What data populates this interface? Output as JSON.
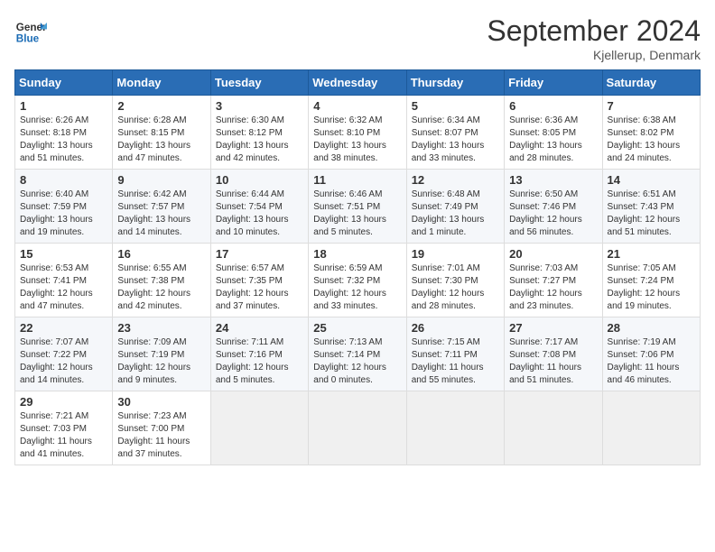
{
  "header": {
    "logo_line1": "General",
    "logo_line2": "Blue",
    "month_title": "September 2024",
    "location": "Kjellerup, Denmark"
  },
  "weekdays": [
    "Sunday",
    "Monday",
    "Tuesday",
    "Wednesday",
    "Thursday",
    "Friday",
    "Saturday"
  ],
  "weeks": [
    [
      {
        "day": "1",
        "sunrise": "6:26 AM",
        "sunset": "8:18 PM",
        "daylight": "13 hours and 51 minutes."
      },
      {
        "day": "2",
        "sunrise": "6:28 AM",
        "sunset": "8:15 PM",
        "daylight": "13 hours and 47 minutes."
      },
      {
        "day": "3",
        "sunrise": "6:30 AM",
        "sunset": "8:12 PM",
        "daylight": "13 hours and 42 minutes."
      },
      {
        "day": "4",
        "sunrise": "6:32 AM",
        "sunset": "8:10 PM",
        "daylight": "13 hours and 38 minutes."
      },
      {
        "day": "5",
        "sunrise": "6:34 AM",
        "sunset": "8:07 PM",
        "daylight": "13 hours and 33 minutes."
      },
      {
        "day": "6",
        "sunrise": "6:36 AM",
        "sunset": "8:05 PM",
        "daylight": "13 hours and 28 minutes."
      },
      {
        "day": "7",
        "sunrise": "6:38 AM",
        "sunset": "8:02 PM",
        "daylight": "13 hours and 24 minutes."
      }
    ],
    [
      {
        "day": "8",
        "sunrise": "6:40 AM",
        "sunset": "7:59 PM",
        "daylight": "13 hours and 19 minutes."
      },
      {
        "day": "9",
        "sunrise": "6:42 AM",
        "sunset": "7:57 PM",
        "daylight": "13 hours and 14 minutes."
      },
      {
        "day": "10",
        "sunrise": "6:44 AM",
        "sunset": "7:54 PM",
        "daylight": "13 hours and 10 minutes."
      },
      {
        "day": "11",
        "sunrise": "6:46 AM",
        "sunset": "7:51 PM",
        "daylight": "13 hours and 5 minutes."
      },
      {
        "day": "12",
        "sunrise": "6:48 AM",
        "sunset": "7:49 PM",
        "daylight": "13 hours and 1 minute."
      },
      {
        "day": "13",
        "sunrise": "6:50 AM",
        "sunset": "7:46 PM",
        "daylight": "12 hours and 56 minutes."
      },
      {
        "day": "14",
        "sunrise": "6:51 AM",
        "sunset": "7:43 PM",
        "daylight": "12 hours and 51 minutes."
      }
    ],
    [
      {
        "day": "15",
        "sunrise": "6:53 AM",
        "sunset": "7:41 PM",
        "daylight": "12 hours and 47 minutes."
      },
      {
        "day": "16",
        "sunrise": "6:55 AM",
        "sunset": "7:38 PM",
        "daylight": "12 hours and 42 minutes."
      },
      {
        "day": "17",
        "sunrise": "6:57 AM",
        "sunset": "7:35 PM",
        "daylight": "12 hours and 37 minutes."
      },
      {
        "day": "18",
        "sunrise": "6:59 AM",
        "sunset": "7:32 PM",
        "daylight": "12 hours and 33 minutes."
      },
      {
        "day": "19",
        "sunrise": "7:01 AM",
        "sunset": "7:30 PM",
        "daylight": "12 hours and 28 minutes."
      },
      {
        "day": "20",
        "sunrise": "7:03 AM",
        "sunset": "7:27 PM",
        "daylight": "12 hours and 23 minutes."
      },
      {
        "day": "21",
        "sunrise": "7:05 AM",
        "sunset": "7:24 PM",
        "daylight": "12 hours and 19 minutes."
      }
    ],
    [
      {
        "day": "22",
        "sunrise": "7:07 AM",
        "sunset": "7:22 PM",
        "daylight": "12 hours and 14 minutes."
      },
      {
        "day": "23",
        "sunrise": "7:09 AM",
        "sunset": "7:19 PM",
        "daylight": "12 hours and 9 minutes."
      },
      {
        "day": "24",
        "sunrise": "7:11 AM",
        "sunset": "7:16 PM",
        "daylight": "12 hours and 5 minutes."
      },
      {
        "day": "25",
        "sunrise": "7:13 AM",
        "sunset": "7:14 PM",
        "daylight": "12 hours and 0 minutes."
      },
      {
        "day": "26",
        "sunrise": "7:15 AM",
        "sunset": "7:11 PM",
        "daylight": "11 hours and 55 minutes."
      },
      {
        "day": "27",
        "sunrise": "7:17 AM",
        "sunset": "7:08 PM",
        "daylight": "11 hours and 51 minutes."
      },
      {
        "day": "28",
        "sunrise": "7:19 AM",
        "sunset": "7:06 PM",
        "daylight": "11 hours and 46 minutes."
      }
    ],
    [
      {
        "day": "29",
        "sunrise": "7:21 AM",
        "sunset": "7:03 PM",
        "daylight": "11 hours and 41 minutes."
      },
      {
        "day": "30",
        "sunrise": "7:23 AM",
        "sunset": "7:00 PM",
        "daylight": "11 hours and 37 minutes."
      },
      null,
      null,
      null,
      null,
      null
    ]
  ],
  "labels": {
    "sunrise_prefix": "Sunrise: ",
    "sunset_prefix": "Sunset: ",
    "daylight_label": "Daylight hours"
  }
}
